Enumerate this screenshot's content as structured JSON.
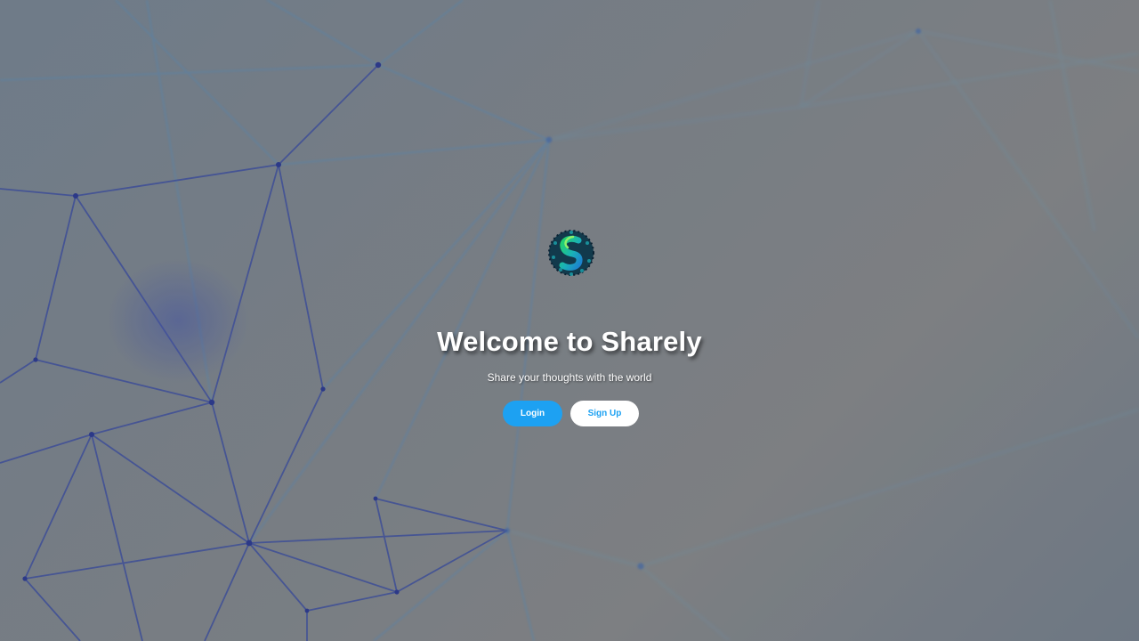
{
  "hero": {
    "logo": {
      "icon": "sharely-logo-icon",
      "colors": [
        "#1fc98a",
        "#1aa5c8",
        "#0d2a48"
      ]
    },
    "title": "Welcome to Sharely",
    "subtitle": "Share your thoughts with the world"
  },
  "actions": {
    "login_label": "Login",
    "signup_label": "Sign Up"
  },
  "theme": {
    "accent": "#1da1f2",
    "background_pattern": "network-mesh"
  }
}
